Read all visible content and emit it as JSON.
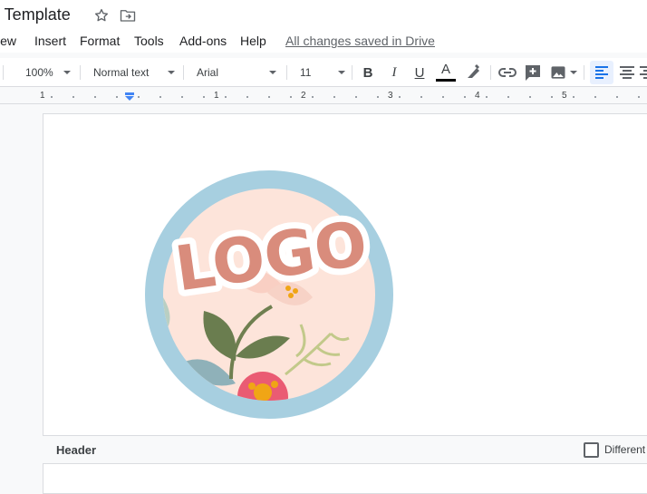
{
  "document": {
    "title": "e Template"
  },
  "menu": [
    "iew",
    "Insert",
    "Format",
    "Tools",
    "Add-ons",
    "Help"
  ],
  "save_status": "All changes saved in Drive",
  "toolbar": {
    "zoom": "100%",
    "style": "Normal text",
    "font": "Arial",
    "font_size": "11",
    "icons": [
      "bold-icon",
      "italic-icon",
      "underline-icon",
      "text-color-icon",
      "highlight-icon",
      "link-icon",
      "comment-icon",
      "image-icon",
      "align-left-icon",
      "align-center-icon"
    ],
    "bold_label": "B",
    "italic_label": "I",
    "underline_label": "U",
    "text_color_label": "A"
  },
  "ruler": {
    "numbers": [
      "1",
      "1",
      "2",
      "3",
      "4",
      "5"
    ]
  },
  "logo": {
    "text": "LOGO"
  },
  "header_bar": {
    "label": "Header",
    "checkbox_label": "Different f"
  },
  "colors": {
    "accent": "#1a73e8",
    "logo_ring": "#a7cfe0",
    "logo_bg": "#fde4da",
    "logo_text": "#d98c7c"
  }
}
